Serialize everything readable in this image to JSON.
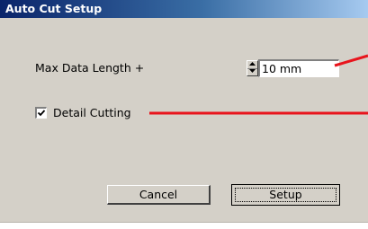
{
  "window": {
    "title": "Auto Cut Setup"
  },
  "form": {
    "max_length_label": "Max Data Length +",
    "max_length_value": "10 mm",
    "detail_cutting_label": "Detail Cutting",
    "detail_cutting_checked": true
  },
  "buttons": {
    "cancel_label": "Cancel",
    "setup_label": "Setup"
  },
  "icons": {
    "spinner": "spin-arrows-icon",
    "checkmark": "checkmark-icon"
  },
  "colors": {
    "callout_red": "#e8141c",
    "dialog_bg": "#d4d0c8",
    "titlebar_dark": "#0a246a"
  }
}
